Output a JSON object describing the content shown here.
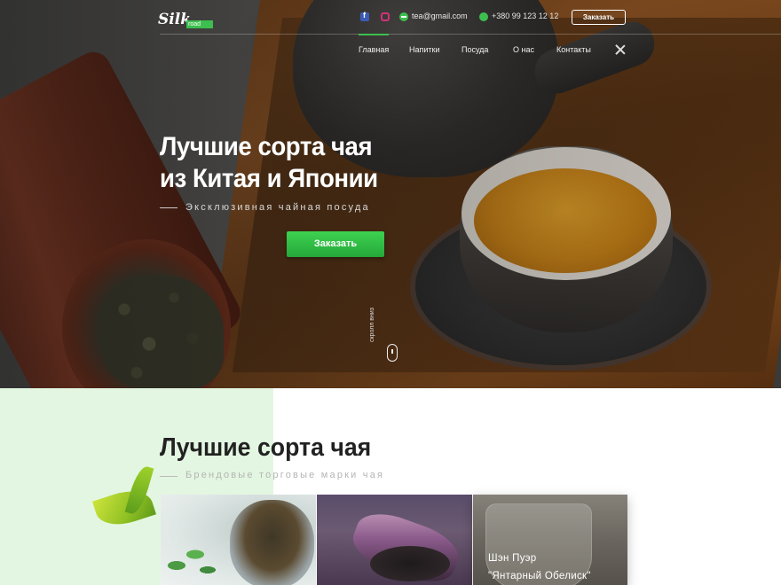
{
  "header": {
    "logo_text": "Silk",
    "logo_tag": "road",
    "email": "tea@gmail.com",
    "phone": "+380 99 123 12 12",
    "order_button": "Заказать",
    "social_icons": [
      "facebook-icon",
      "instagram-icon",
      "mail-icon",
      "phone-icon"
    ]
  },
  "nav": {
    "items": [
      {
        "label": "Главная",
        "active": true
      },
      {
        "label": "Напитки",
        "active": false
      },
      {
        "label": "Посуда",
        "active": false
      },
      {
        "label": "О нас",
        "active": false
      },
      {
        "label": "Контакты",
        "active": false
      }
    ]
  },
  "hero": {
    "title_line1": "Лучшие сорта чая",
    "title_line2": "из Китая и Японии",
    "subtitle": "Эксклюзивная чайная посуда",
    "order_button": "Заказать",
    "scroll_label": "скролл вниз"
  },
  "section": {
    "title": "Лучшие сорта чая",
    "subtitle": "Брендовые торговые марки чая",
    "cards": [
      {
        "title_line1": "",
        "title_line2": ""
      },
      {
        "title_line1": "",
        "title_line2": ""
      },
      {
        "title_line1": "Шэн Пуэр",
        "title_line2": "\"Янтарный Обелиск\""
      }
    ]
  },
  "colors": {
    "accent": "#3cbf4e",
    "mint_background": "#e3f6e1",
    "facebook": "#3b5bb5",
    "instagram": "#d0327a"
  }
}
